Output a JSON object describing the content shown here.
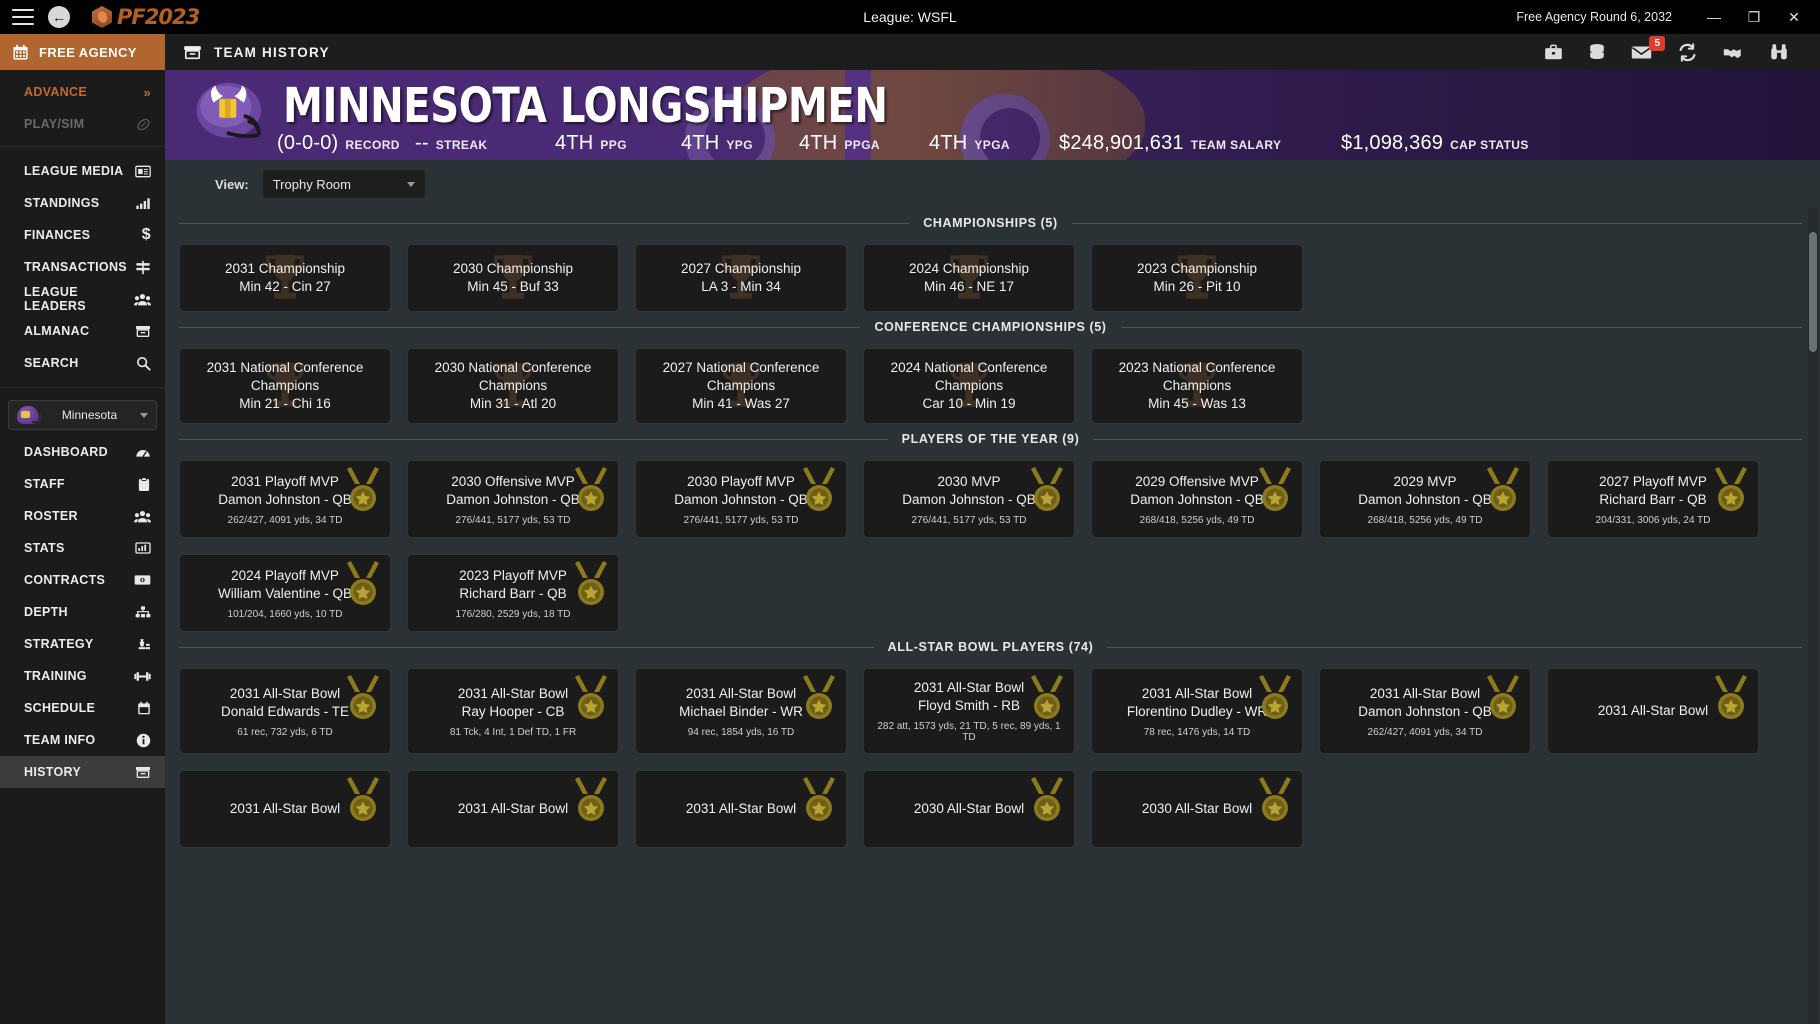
{
  "titlebar": {
    "app_logo_text": "PF2023",
    "center_title": "League: WSFL",
    "season_status": "Free Agency Round 6, 2032",
    "minimize": "—",
    "restore": "❐",
    "close": "✕"
  },
  "sidebar": {
    "free_agency_label": "FREE AGENCY",
    "top_items": [
      {
        "label": "ADVANCE",
        "icon": "double-chevron-right-icon",
        "state": "accent"
      },
      {
        "label": "PLAY/SIM",
        "icon": "football-icon",
        "state": "disabled"
      }
    ],
    "league_items": [
      {
        "label": "LEAGUE MEDIA",
        "icon": "newspaper-icon"
      },
      {
        "label": "STANDINGS",
        "icon": "bar-chart-icon"
      },
      {
        "label": "FINANCES",
        "icon": "dollar-icon"
      },
      {
        "label": "TRANSACTIONS",
        "icon": "signpost-icon"
      },
      {
        "label": "LEAGUE LEADERS",
        "icon": "people-group-icon"
      },
      {
        "label": "ALMANAC",
        "icon": "archive-box-icon"
      },
      {
        "label": "SEARCH",
        "icon": "magnifier-icon"
      }
    ],
    "team_selector": {
      "team": "Minnesota",
      "icon": "helmet-icon",
      "caret": "chevron-down-icon"
    },
    "team_items": [
      {
        "label": "DASHBOARD",
        "icon": "gauge-icon",
        "active": false
      },
      {
        "label": "STAFF",
        "icon": "clipboard-icon",
        "active": false
      },
      {
        "label": "ROSTER",
        "icon": "people-group-icon",
        "active": false
      },
      {
        "label": "STATS",
        "icon": "chart-icon",
        "active": false
      },
      {
        "label": "CONTRACTS",
        "icon": "banknote-icon",
        "active": false
      },
      {
        "label": "DEPTH",
        "icon": "hierarchy-icon",
        "active": false
      },
      {
        "label": "STRATEGY",
        "icon": "chess-icon",
        "active": false
      },
      {
        "label": "TRAINING",
        "icon": "dumbbell-icon",
        "active": false
      },
      {
        "label": "SCHEDULE",
        "icon": "calendar-icon",
        "active": false
      },
      {
        "label": "TEAM INFO",
        "icon": "info-circle-icon",
        "active": false
      },
      {
        "label": "HISTORY",
        "icon": "archive-box-icon",
        "active": true
      }
    ]
  },
  "page": {
    "title": "TEAM HISTORY",
    "title_icon": "archive-box-icon",
    "toolbar_icons": [
      {
        "name": "briefcase-icon",
        "badge": ""
      },
      {
        "name": "database-icon",
        "badge": ""
      },
      {
        "name": "mail-icon",
        "badge": "5"
      },
      {
        "name": "refresh-icon",
        "badge": ""
      },
      {
        "name": "handshake-icon",
        "badge": ""
      },
      {
        "name": "binoculars-icon",
        "badge": ""
      }
    ]
  },
  "team_banner": {
    "name": "MINNESOTA LONGSHIPMEN",
    "primary_color": "#4a2a74",
    "stats": [
      {
        "value": "(0-0-0)",
        "label": "RECORD"
      },
      {
        "value": "--",
        "label": "STREAK"
      },
      {
        "value": "4TH",
        "label": "PPG"
      },
      {
        "value": "4TH",
        "label": "YPG"
      },
      {
        "value": "4TH",
        "label": "PPGA"
      },
      {
        "value": "4TH",
        "label": "YPGA"
      },
      {
        "value": "$248,901,631",
        "label": "TEAM SALARY"
      },
      {
        "value": "$1,098,369",
        "label": "CAP STATUS"
      }
    ]
  },
  "view_control": {
    "label": "View:",
    "value": "Trophy Room",
    "caret": "chevron-down-icon"
  },
  "sections": [
    {
      "title": "CHAMPIONSHIPS (5)",
      "card_kind": "trophy",
      "cards": [
        {
          "line1": "2031 Championship",
          "line2": "Min 42 - Cin 27",
          "stat": ""
        },
        {
          "line1": "2030 Championship",
          "line2": "Min 45 - Buf 33",
          "stat": ""
        },
        {
          "line1": "2027 Championship",
          "line2": "LA 3 - Min 34",
          "stat": ""
        },
        {
          "line1": "2024 Championship",
          "line2": "Min 46 - NE 17",
          "stat": ""
        },
        {
          "line1": "2023 Championship",
          "line2": "Min 26 - Pit 10",
          "stat": ""
        }
      ]
    },
    {
      "title": "CONFERENCE CHAMPIONSHIPS (5)",
      "card_kind": "trophy",
      "cards": [
        {
          "line1": "2031 National Conference Champions",
          "line2": "Min 21 - Chi 16",
          "stat": ""
        },
        {
          "line1": "2030 National Conference Champions",
          "line2": "Min 31 - Atl 20",
          "stat": ""
        },
        {
          "line1": "2027 National Conference Champions",
          "line2": "Min 41 - Was 27",
          "stat": ""
        },
        {
          "line1": "2024 National Conference Champions",
          "line2": "Car 10 - Min 19",
          "stat": ""
        },
        {
          "line1": "2023 National Conference Champions",
          "line2": "Min 45 - Was 13",
          "stat": ""
        }
      ]
    },
    {
      "title": "PLAYERS OF THE YEAR (9)",
      "card_kind": "medal",
      "cards": [
        {
          "line1": "2031 Playoff MVP",
          "line2": "Damon Johnston - QB",
          "stat": "262/427, 4091 yds, 34 TD"
        },
        {
          "line1": "2030 Offensive MVP",
          "line2": "Damon Johnston - QB",
          "stat": "276/441, 5177 yds, 53 TD"
        },
        {
          "line1": "2030 Playoff MVP",
          "line2": "Damon Johnston - QB",
          "stat": "276/441, 5177 yds, 53 TD"
        },
        {
          "line1": "2030 MVP",
          "line2": "Damon Johnston - QB",
          "stat": "276/441, 5177 yds, 53 TD"
        },
        {
          "line1": "2029 Offensive MVP",
          "line2": "Damon Johnston - QB",
          "stat": "268/418, 5256 yds, 49 TD"
        },
        {
          "line1": "2029 MVP",
          "line2": "Damon Johnston - QB",
          "stat": "268/418, 5256 yds, 49 TD"
        },
        {
          "line1": "2027 Playoff MVP",
          "line2": "Richard Barr - QB",
          "stat": "204/331, 3006 yds, 24 TD"
        },
        {
          "line1": "2024 Playoff MVP",
          "line2": "William Valentine - QB",
          "stat": "101/204, 1660 yds, 10 TD"
        },
        {
          "line1": "2023 Playoff MVP",
          "line2": "Richard Barr - QB",
          "stat": "176/280, 2529 yds, 18 TD"
        }
      ]
    },
    {
      "title": "ALL-STAR BOWL PLAYERS (74)",
      "card_kind": "medal",
      "cards": [
        {
          "line1": "2031 All-Star Bowl",
          "line2": "Donald Edwards - TE",
          "stat": "61 rec, 732 yds, 6 TD"
        },
        {
          "line1": "2031 All-Star Bowl",
          "line2": "Ray Hooper - CB",
          "stat": "81 Tck, 4 Int, 1 Def TD, 1 FR"
        },
        {
          "line1": "2031 All-Star Bowl",
          "line2": "Michael Binder - WR",
          "stat": "94 rec, 1854 yds, 16 TD"
        },
        {
          "line1": "2031 All-Star Bowl",
          "line2": "Floyd Smith - RB",
          "stat": "282 att, 1573 yds, 21 TD, 5 rec, 89 yds, 1 TD"
        },
        {
          "line1": "2031 All-Star Bowl",
          "line2": "Florentino Dudley - WR",
          "stat": "78 rec, 1476 yds, 14 TD"
        },
        {
          "line1": "2031 All-Star Bowl",
          "line2": "Damon Johnston - QB",
          "stat": "262/427, 4091 yds, 34 TD"
        },
        {
          "line1": "2031 All-Star Bowl",
          "line2": "",
          "stat": ""
        },
        {
          "line1": "2031 All-Star Bowl",
          "line2": "",
          "stat": ""
        },
        {
          "line1": "2031 All-Star Bowl",
          "line2": "",
          "stat": ""
        },
        {
          "line1": "2031 All-Star Bowl",
          "line2": "",
          "stat": ""
        },
        {
          "line1": "2030 All-Star Bowl",
          "line2": "",
          "stat": ""
        },
        {
          "line1": "2030 All-Star Bowl",
          "line2": "",
          "stat": ""
        }
      ]
    }
  ]
}
